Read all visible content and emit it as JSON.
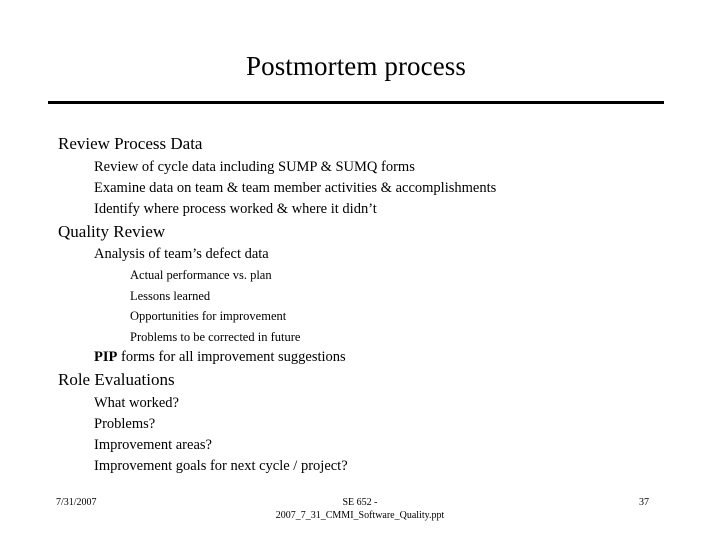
{
  "slide": {
    "title": "Postmortem process",
    "outline": [
      {
        "level": 1,
        "text": "Review Process Data"
      },
      {
        "level": 2,
        "text": "Review of cycle data including SUMP & SUMQ forms"
      },
      {
        "level": 2,
        "text": "Examine data on team & team member activities & accomplishments"
      },
      {
        "level": 2,
        "text": "Identify where process worked & where it didn’t"
      },
      {
        "level": 1,
        "text": "Quality Review"
      },
      {
        "level": 2,
        "text": "Analysis of team’s defect data"
      },
      {
        "level": 3,
        "text": "Actual performance vs. plan"
      },
      {
        "level": 3,
        "text": "Lessons learned"
      },
      {
        "level": 3,
        "text": "Opportunities for improvement"
      },
      {
        "level": 3,
        "text": "Problems to be corrected in future"
      },
      {
        "level": 2,
        "bold_prefix": "PIP",
        "text": " forms for all improvement suggestions"
      },
      {
        "level": 1,
        "text": "Role Evaluations"
      },
      {
        "level": 2,
        "text": "What worked?"
      },
      {
        "level": 2,
        "text": "Problems?"
      },
      {
        "level": 2,
        "text": "Improvement areas?"
      },
      {
        "level": 2,
        "text": "Improvement goals for next cycle / project?"
      }
    ]
  },
  "footer": {
    "date": "7/31/2007",
    "center_line1": "SE 652 -",
    "center_line2": "2007_7_31_CMMI_Software_Quality.ppt",
    "page_number": "37"
  },
  "colors": {
    "text": "#000000",
    "background": "#ffffff",
    "rule": "#000000"
  }
}
